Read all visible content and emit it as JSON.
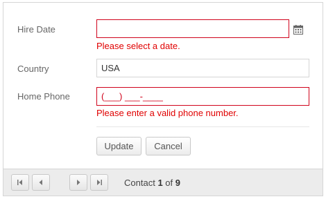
{
  "form": {
    "hire_date": {
      "label": "Hire Date",
      "value": "",
      "error": "Please select a date."
    },
    "country": {
      "label": "Country",
      "value": "USA"
    },
    "home_phone": {
      "label": "Home Phone",
      "mask": "(___) ___-____",
      "error": "Please enter a valid phone number."
    },
    "buttons": {
      "update": "Update",
      "cancel": "Cancel"
    }
  },
  "pager": {
    "prefix": "Contact",
    "current": "1",
    "of": "of",
    "total": "9"
  },
  "colors": {
    "error": "#e00000",
    "border": "#d5d5d5",
    "pager_bg": "#ececec"
  }
}
